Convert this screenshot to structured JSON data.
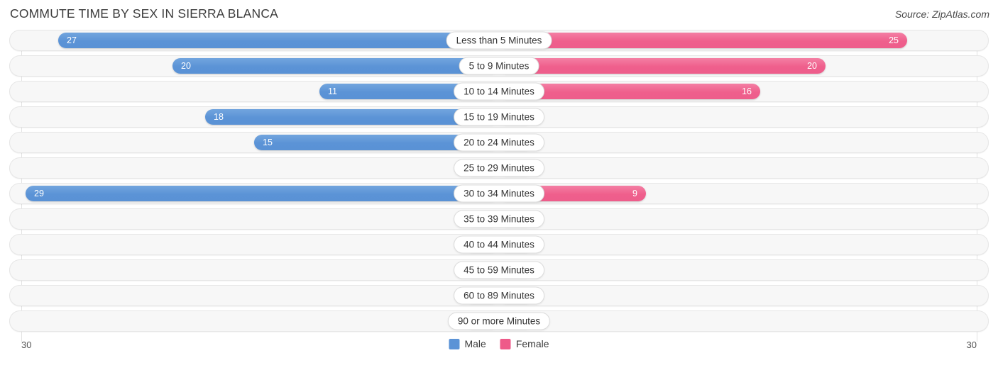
{
  "header": {
    "title": "COMMUTE TIME BY SEX IN SIERRA BLANCA",
    "source": "Source: ZipAtlas.com"
  },
  "legend": {
    "male_label": "Male",
    "female_label": "Female",
    "male_color": "#5b93d6",
    "female_color": "#ee5a89"
  },
  "axis": {
    "left_max": "30",
    "right_max": "30"
  },
  "chart_data": {
    "type": "bar",
    "title": "Commute Time by Sex in Sierra Blanca",
    "subtitle": "Source: ZipAtlas.com",
    "orientation": "horizontal-diverging",
    "xlabel": "",
    "ylabel": "",
    "xlim": [
      30,
      30
    ],
    "grid": true,
    "legend_position": "bottom-center",
    "categories": [
      "Less than 5 Minutes",
      "5 to 9 Minutes",
      "10 to 14 Minutes",
      "15 to 19 Minutes",
      "20 to 24 Minutes",
      "25 to 29 Minutes",
      "30 to 34 Minutes",
      "35 to 39 Minutes",
      "40 to 44 Minutes",
      "45 to 59 Minutes",
      "60 to 89 Minutes",
      "90 or more Minutes"
    ],
    "series": [
      {
        "name": "Male",
        "values": [
          27,
          20,
          11,
          18,
          15,
          0,
          29,
          0,
          0,
          0,
          0,
          0
        ]
      },
      {
        "name": "Female",
        "values": [
          25,
          20,
          16,
          0,
          0,
          0,
          9,
          0,
          0,
          0,
          0,
          0
        ]
      }
    ]
  },
  "rows": [
    {
      "label": "Less than 5 Minutes",
      "male": "27",
      "female": "25"
    },
    {
      "label": "5 to 9 Minutes",
      "male": "20",
      "female": "20"
    },
    {
      "label": "10 to 14 Minutes",
      "male": "11",
      "female": "16"
    },
    {
      "label": "15 to 19 Minutes",
      "male": "18",
      "female": "0"
    },
    {
      "label": "20 to 24 Minutes",
      "male": "15",
      "female": "0"
    },
    {
      "label": "25 to 29 Minutes",
      "male": "0",
      "female": "0"
    },
    {
      "label": "30 to 34 Minutes",
      "male": "29",
      "female": "9"
    },
    {
      "label": "35 to 39 Minutes",
      "male": "0",
      "female": "0"
    },
    {
      "label": "40 to 44 Minutes",
      "male": "0",
      "female": "0"
    },
    {
      "label": "45 to 59 Minutes",
      "male": "0",
      "female": "0"
    },
    {
      "label": "60 to 89 Minutes",
      "male": "0",
      "female": "0"
    },
    {
      "label": "90 or more Minutes",
      "male": "0",
      "female": "0"
    }
  ]
}
